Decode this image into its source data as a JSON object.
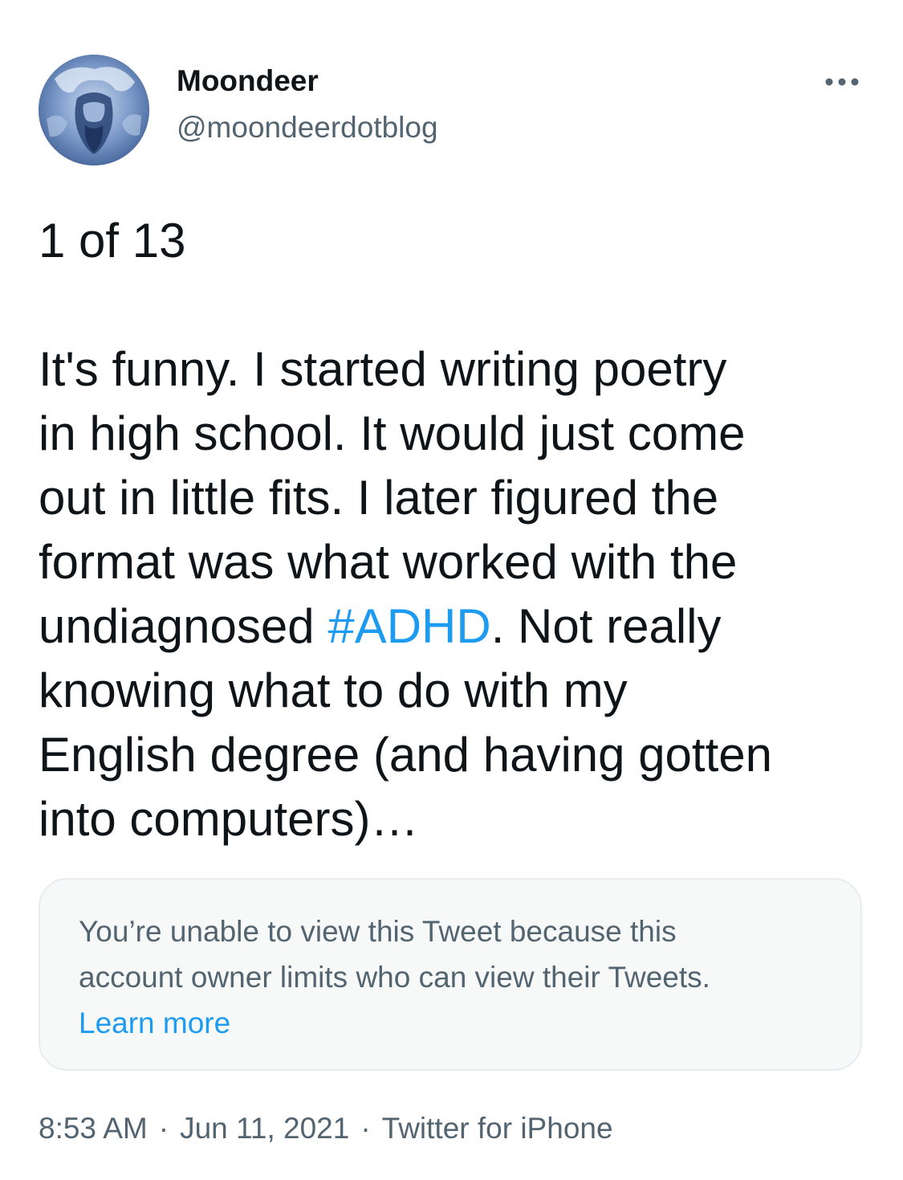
{
  "tweet": {
    "author": {
      "display_name": "Moondeer",
      "handle": "@moondeerdotblog",
      "avatar_icon": "avatar-image"
    },
    "more_icon": "more-dots-icon",
    "counter": "1 of 13",
    "body_lines": [
      "It's funny. I started writing poetry",
      "in high school. It would just come",
      "out in little fits. I later figured the",
      "format was what worked with the"
    ],
    "hashtag_line": {
      "before": "undiagnosed ",
      "hashtag": "#ADHD",
      "after": ". Not really"
    },
    "body_lines_after": [
      "knowing what to do with my",
      "English degree (and having gotten",
      "into computers)…"
    ],
    "notice": {
      "lines": [
        "You’re unable to view this Tweet because this",
        "account owner limits who can view their Tweets."
      ],
      "link": "Learn more"
    },
    "meta": {
      "time": "8:53 AM",
      "separator": "·",
      "date": "Jun 11, 2021",
      "source": "Twitter for iPhone"
    }
  },
  "colors": {
    "text": "#0f1419",
    "secondary": "#536471",
    "link": "#1d9bf0",
    "notice_bg": "#f7f9f9",
    "notice_border": "#e7ecf0"
  }
}
